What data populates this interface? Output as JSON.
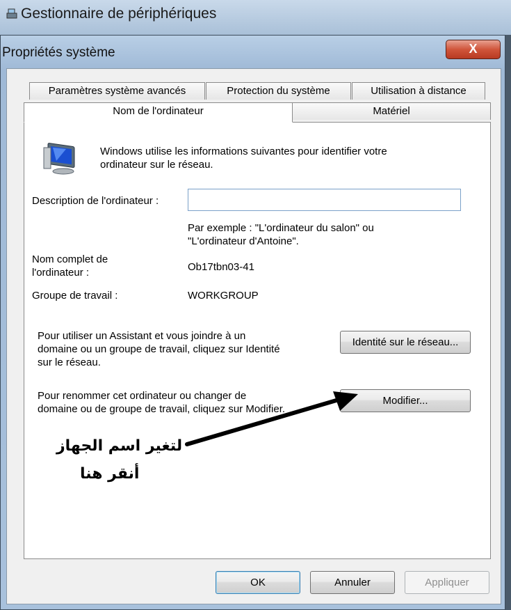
{
  "background_window": {
    "title": "Gestionnaire de périphériques"
  },
  "dialog": {
    "title": "Propriétés système",
    "close_label": "X"
  },
  "tabs": {
    "row1": [
      "Paramètres système avancés",
      "Protection du système",
      "Utilisation à distance"
    ],
    "row2": [
      "Nom de l'ordinateur",
      "Matériel"
    ]
  },
  "content": {
    "intro_line1": "Windows utilise les informations suivantes pour identifier votre",
    "intro_line2": "ordinateur sur le réseau.",
    "description_label": "Description de l'ordinateur :",
    "description_value": "",
    "example_line1": "Par exemple : \"L'ordinateur du salon\" ou",
    "example_line2": "\"L'ordinateur d'Antoine\".",
    "fullname_label_line1": "Nom complet de",
    "fullname_label_line2": "l'ordinateur :",
    "fullname_value": "Ob17tbn03-41",
    "workgroup_label": "Groupe de travail :",
    "workgroup_value": "WORKGROUP",
    "assistant_line1": "Pour utiliser un Assistant et vous joindre à un",
    "assistant_line2": "domaine ou un groupe de travail, cliquez sur Identité",
    "assistant_line3": "sur le réseau.",
    "network_id_button": "Identité sur le réseau...",
    "rename_line1": "Pour renommer cet ordinateur ou changer de",
    "rename_line2": "domaine ou de groupe de travail, cliquez sur Modifier.",
    "modify_button": "Modifier..."
  },
  "annotation": {
    "line1": "لتغير اسم الجهاز",
    "line2": "أنقر هنا"
  },
  "footer": {
    "ok": "OK",
    "cancel": "Annuler",
    "apply": "Appliquer"
  }
}
